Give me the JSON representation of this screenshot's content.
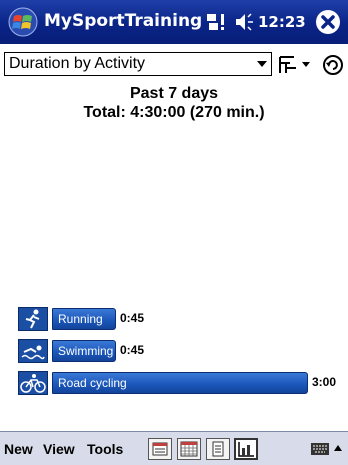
{
  "titlebar": {
    "app_title": "MySportTraining",
    "time": "12:23",
    "start_icon": "windows-flag-icon",
    "close_icon": "close-icon"
  },
  "toolbar": {
    "dropdown_value": "Duration by Activity",
    "view_icon": "view-toggle-icon",
    "refresh_icon": "refresh-icon"
  },
  "summary": {
    "period": "Past 7 days",
    "total": "Total: 4:30:00 (270 min.)"
  },
  "chart_data": {
    "type": "bar",
    "orientation": "horizontal",
    "categories": [
      "Running",
      "Swimming",
      "Road cycling"
    ],
    "values_minutes": [
      45,
      45,
      180
    ],
    "value_labels": [
      "0:45",
      "0:45",
      "3:00"
    ],
    "icons": [
      "running-icon",
      "swimming-icon",
      "cycling-icon"
    ]
  },
  "cmdbar": {
    "menu": [
      "New",
      "View",
      "Tools"
    ],
    "buttons": [
      "list-view-icon",
      "calendar-icon",
      "notes-icon",
      "chart-icon"
    ],
    "active_button": "chart-icon",
    "keyboard_icon": "keyboard-icon"
  },
  "colors": {
    "titlebar": "#0a2487",
    "bar": "#1a56b8"
  }
}
